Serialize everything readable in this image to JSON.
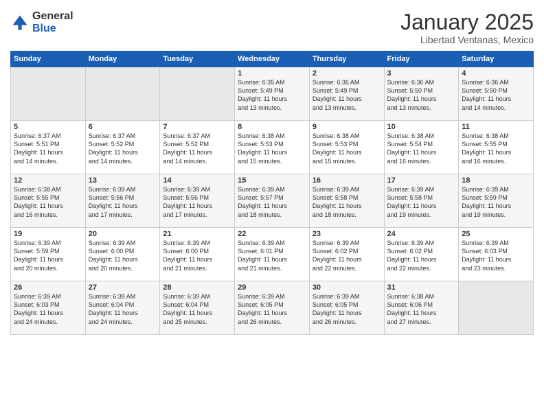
{
  "logo": {
    "general": "General",
    "blue": "Blue"
  },
  "header": {
    "title": "January 2025",
    "subtitle": "Libertad Ventanas, Mexico"
  },
  "days": [
    "Sunday",
    "Monday",
    "Tuesday",
    "Wednesday",
    "Thursday",
    "Friday",
    "Saturday"
  ],
  "weeks": [
    [
      {
        "num": "",
        "info": ""
      },
      {
        "num": "",
        "info": ""
      },
      {
        "num": "",
        "info": ""
      },
      {
        "num": "1",
        "info": "Sunrise: 6:35 AM\nSunset: 5:49 PM\nDaylight: 11 hours\nand 13 minutes."
      },
      {
        "num": "2",
        "info": "Sunrise: 6:36 AM\nSunset: 5:49 PM\nDaylight: 11 hours\nand 13 minutes."
      },
      {
        "num": "3",
        "info": "Sunrise: 6:36 AM\nSunset: 5:50 PM\nDaylight: 11 hours\nand 13 minutes."
      },
      {
        "num": "4",
        "info": "Sunrise: 6:36 AM\nSunset: 5:50 PM\nDaylight: 11 hours\nand 14 minutes."
      }
    ],
    [
      {
        "num": "5",
        "info": "Sunrise: 6:37 AM\nSunset: 5:51 PM\nDaylight: 11 hours\nand 14 minutes."
      },
      {
        "num": "6",
        "info": "Sunrise: 6:37 AM\nSunset: 5:52 PM\nDaylight: 11 hours\nand 14 minutes."
      },
      {
        "num": "7",
        "info": "Sunrise: 6:37 AM\nSunset: 5:52 PM\nDaylight: 11 hours\nand 14 minutes."
      },
      {
        "num": "8",
        "info": "Sunrise: 6:38 AM\nSunset: 5:53 PM\nDaylight: 11 hours\nand 15 minutes."
      },
      {
        "num": "9",
        "info": "Sunrise: 6:38 AM\nSunset: 5:53 PM\nDaylight: 11 hours\nand 15 minutes."
      },
      {
        "num": "10",
        "info": "Sunrise: 6:38 AM\nSunset: 5:54 PM\nDaylight: 11 hours\nand 16 minutes."
      },
      {
        "num": "11",
        "info": "Sunrise: 6:38 AM\nSunset: 5:55 PM\nDaylight: 11 hours\nand 16 minutes."
      }
    ],
    [
      {
        "num": "12",
        "info": "Sunrise: 6:38 AM\nSunset: 5:55 PM\nDaylight: 11 hours\nand 16 minutes."
      },
      {
        "num": "13",
        "info": "Sunrise: 6:39 AM\nSunset: 5:56 PM\nDaylight: 11 hours\nand 17 minutes."
      },
      {
        "num": "14",
        "info": "Sunrise: 6:39 AM\nSunset: 5:56 PM\nDaylight: 11 hours\nand 17 minutes."
      },
      {
        "num": "15",
        "info": "Sunrise: 6:39 AM\nSunset: 5:57 PM\nDaylight: 11 hours\nand 18 minutes."
      },
      {
        "num": "16",
        "info": "Sunrise: 6:39 AM\nSunset: 5:58 PM\nDaylight: 11 hours\nand 18 minutes."
      },
      {
        "num": "17",
        "info": "Sunrise: 6:39 AM\nSunset: 5:58 PM\nDaylight: 11 hours\nand 19 minutes."
      },
      {
        "num": "18",
        "info": "Sunrise: 6:39 AM\nSunset: 5:59 PM\nDaylight: 11 hours\nand 19 minutes."
      }
    ],
    [
      {
        "num": "19",
        "info": "Sunrise: 6:39 AM\nSunset: 5:59 PM\nDaylight: 11 hours\nand 20 minutes."
      },
      {
        "num": "20",
        "info": "Sunrise: 6:39 AM\nSunset: 6:00 PM\nDaylight: 11 hours\nand 20 minutes."
      },
      {
        "num": "21",
        "info": "Sunrise: 6:39 AM\nSunset: 6:00 PM\nDaylight: 11 hours\nand 21 minutes."
      },
      {
        "num": "22",
        "info": "Sunrise: 6:39 AM\nSunset: 6:01 PM\nDaylight: 11 hours\nand 21 minutes."
      },
      {
        "num": "23",
        "info": "Sunrise: 6:39 AM\nSunset: 6:02 PM\nDaylight: 11 hours\nand 22 minutes."
      },
      {
        "num": "24",
        "info": "Sunrise: 6:39 AM\nSunset: 6:02 PM\nDaylight: 11 hours\nand 22 minutes."
      },
      {
        "num": "25",
        "info": "Sunrise: 6:39 AM\nSunset: 6:03 PM\nDaylight: 11 hours\nand 23 minutes."
      }
    ],
    [
      {
        "num": "26",
        "info": "Sunrise: 6:39 AM\nSunset: 6:03 PM\nDaylight: 11 hours\nand 24 minutes."
      },
      {
        "num": "27",
        "info": "Sunrise: 6:39 AM\nSunset: 6:04 PM\nDaylight: 11 hours\nand 24 minutes."
      },
      {
        "num": "28",
        "info": "Sunrise: 6:39 AM\nSunset: 6:04 PM\nDaylight: 11 hours\nand 25 minutes."
      },
      {
        "num": "29",
        "info": "Sunrise: 6:39 AM\nSunset: 6:05 PM\nDaylight: 11 hours\nand 26 minutes."
      },
      {
        "num": "30",
        "info": "Sunrise: 6:39 AM\nSunset: 6:05 PM\nDaylight: 11 hours\nand 26 minutes."
      },
      {
        "num": "31",
        "info": "Sunrise: 6:38 AM\nSunset: 6:06 PM\nDaylight: 11 hours\nand 27 minutes."
      },
      {
        "num": "",
        "info": ""
      }
    ]
  ]
}
